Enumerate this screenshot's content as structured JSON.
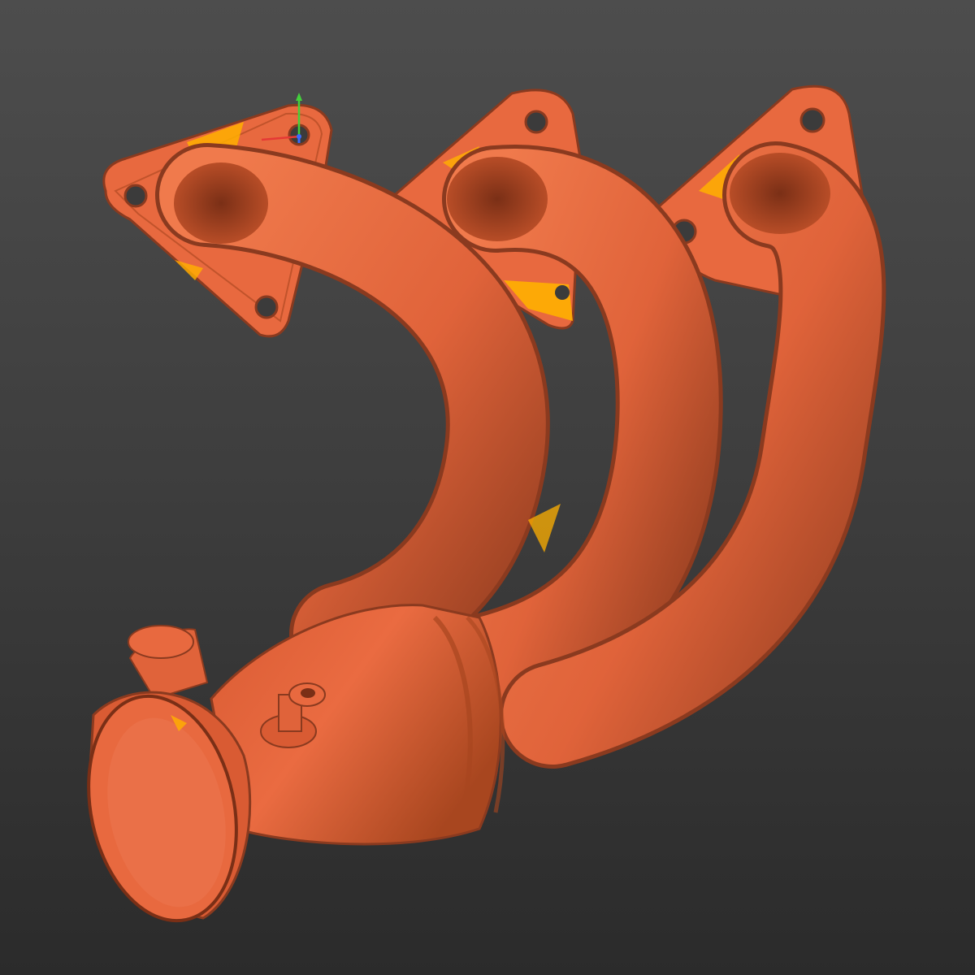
{
  "viewport": {
    "background_top": "#4d4d4d",
    "background_bottom": "#2b2b2b"
  },
  "model": {
    "name": "exhaust-manifold-scan",
    "surface_color": "#e8693f",
    "surface_shadow_color": "#8a3a1f",
    "highlight_color": "#ffb000",
    "flange_count": 3,
    "icon": "mesh-model-icon"
  },
  "axis_gizmo": {
    "x_color": "#e53935",
    "y_color": "#43d13b",
    "z_color": "#3b6bff",
    "icon": "axis-triad-icon"
  }
}
